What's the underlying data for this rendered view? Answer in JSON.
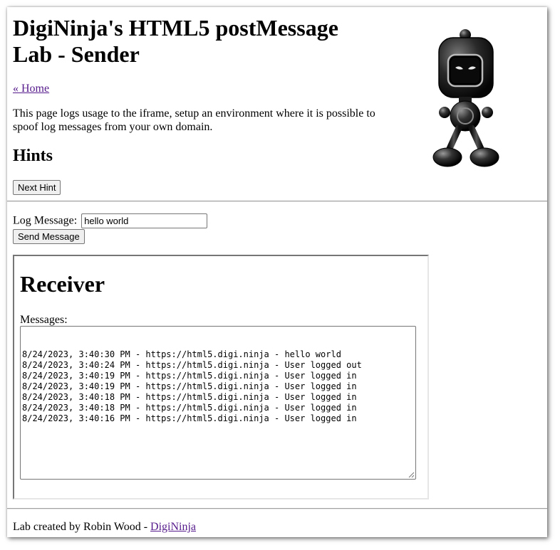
{
  "page": {
    "title": "DigiNinja's HTML5 postMessage Lab - Sender",
    "home_link": "« Home",
    "intro": "This page logs usage to the iframe, setup an environment where it is possible to spoof log messages from your own domain.",
    "hints_heading": "Hints",
    "next_hint_button": "Next Hint"
  },
  "sender_form": {
    "label": "Log Message:",
    "value": "hello world",
    "send_button": "Send Message"
  },
  "receiver": {
    "title": "Receiver",
    "messages_label": "Messages:",
    "messages": [
      "8/24/2023, 3:40:30 PM - https://html5.digi.ninja - hello world",
      "8/24/2023, 3:40:24 PM - https://html5.digi.ninja - User logged out",
      "8/24/2023, 3:40:19 PM - https://html5.digi.ninja - User logged in",
      "8/24/2023, 3:40:19 PM - https://html5.digi.ninja - User logged in",
      "8/24/2023, 3:40:18 PM - https://html5.digi.ninja - User logged in",
      "8/24/2023, 3:40:18 PM - https://html5.digi.ninja - User logged in",
      "8/24/2023, 3:40:16 PM - https://html5.digi.ninja - User logged in"
    ]
  },
  "footer": {
    "text": "Lab created by Robin Wood - ",
    "link": "DigiNinja"
  },
  "images": {
    "logo": "ninja-robot-mascot"
  },
  "colors": {
    "visited_link": "#551a8b",
    "button_bg": "#efefef",
    "border": "#767676"
  }
}
